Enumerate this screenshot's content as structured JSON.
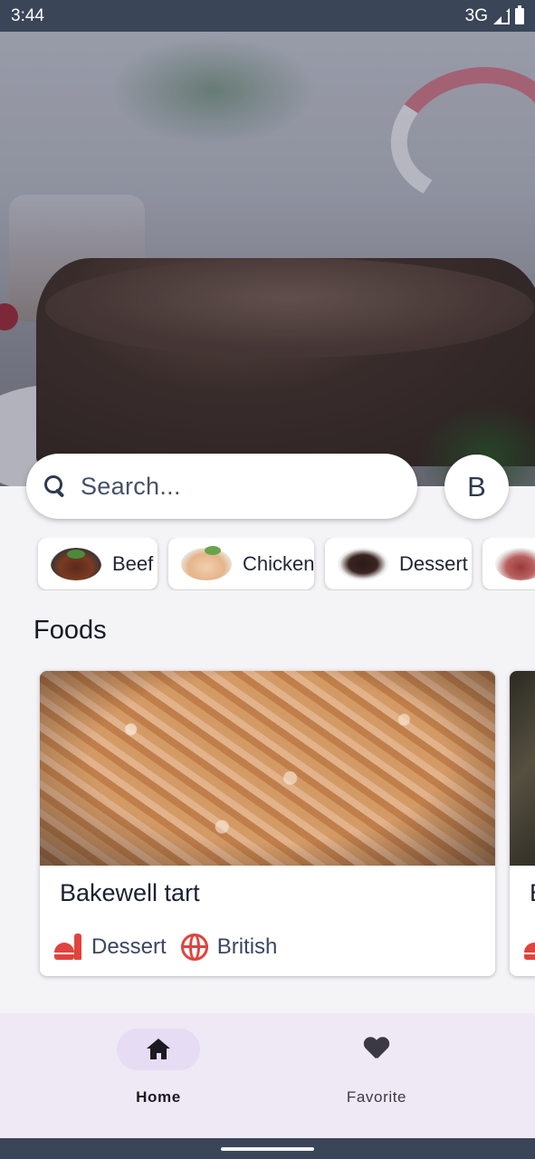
{
  "status_bar": {
    "time": "3:44",
    "network": "3G"
  },
  "search": {
    "placeholder": "Search..."
  },
  "avatar": {
    "initial": "B"
  },
  "categories": [
    {
      "label": "Beef",
      "icon": "beef-thumbnail"
    },
    {
      "label": "Chicken",
      "icon": "chicken-thumbnail"
    },
    {
      "label": "Dessert",
      "icon": "dessert-thumbnail"
    },
    {
      "label": "",
      "icon": "lamb-thumbnail"
    }
  ],
  "foods": {
    "title": "Foods",
    "items": [
      {
        "name": "Bakewell tart",
        "category": "Dessert",
        "area": "British"
      },
      {
        "name": "B",
        "category": "",
        "area": ""
      }
    ]
  },
  "bottom_nav": {
    "items": [
      {
        "label": "Home",
        "icon": "home-icon",
        "active": true
      },
      {
        "label": "Favorite",
        "icon": "heart-icon",
        "active": false
      }
    ]
  },
  "colors": {
    "accent": "#e0433d",
    "status_bar": "#3a4558",
    "nav_background": "#efe9f5",
    "active_pill": "#e6dcf3"
  }
}
